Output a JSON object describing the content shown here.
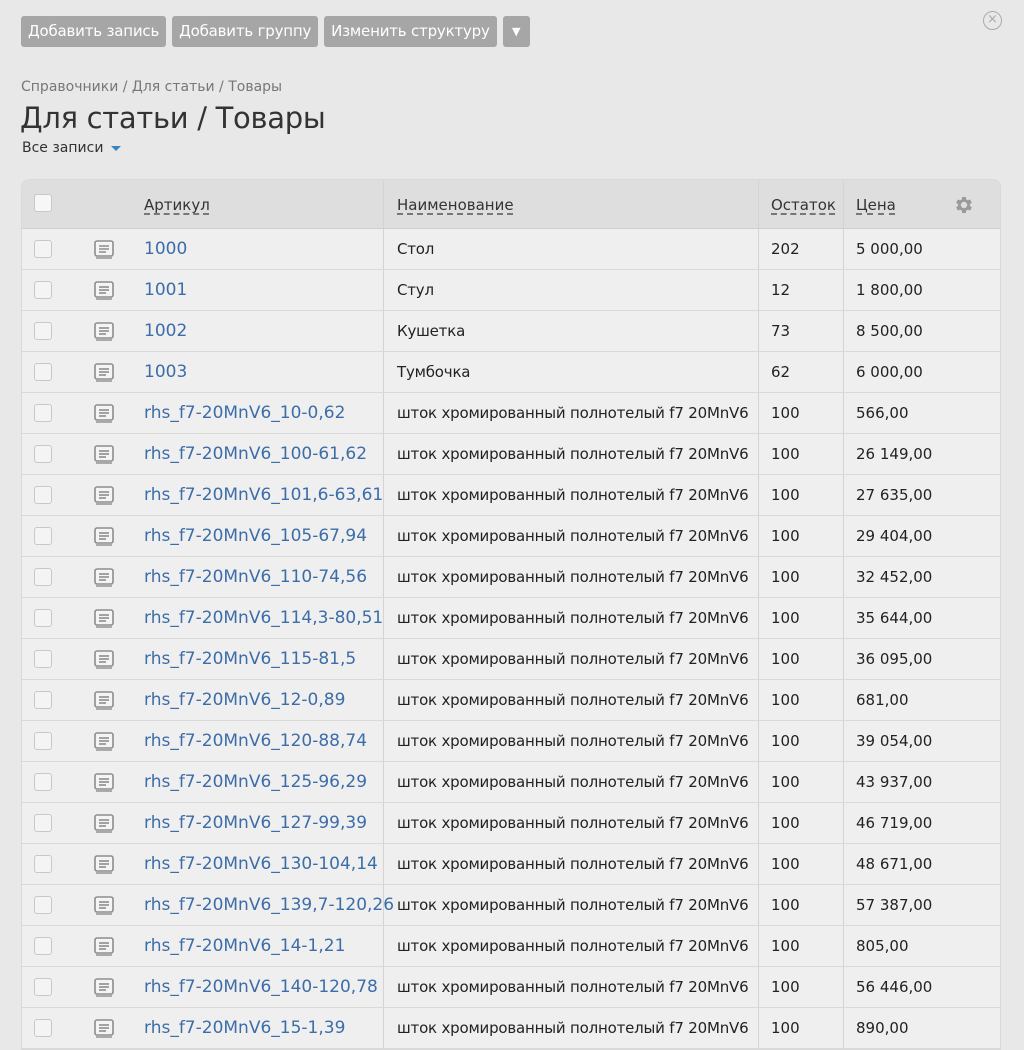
{
  "toolbar": {
    "add_record": "Добавить запись",
    "add_group": "Добавить группу",
    "change_structure": "Изменить структуру",
    "more": "▼"
  },
  "breadcrumb": "Справочники / Для статьи / Товары",
  "title": "Для статьи / Товары",
  "filter": "Все записи",
  "table": {
    "headers": {
      "article": "Артикул",
      "name": "Наименование",
      "stock": "Остаток",
      "price": "Цена"
    },
    "rows": [
      {
        "article": "1000",
        "name": "Стол",
        "stock": "202",
        "price": "5 000,00"
      },
      {
        "article": "1001",
        "name": "Стул",
        "stock": "12",
        "price": "1 800,00"
      },
      {
        "article": "1002",
        "name": "Кушетка",
        "stock": "73",
        "price": "8 500,00"
      },
      {
        "article": "1003",
        "name": "Тумбочка",
        "stock": "62",
        "price": "6 000,00"
      },
      {
        "article": "rhs_f7-20MnV6_10-0,62",
        "name": "шток хромированный полнотелый f7 20MnV6",
        "stock": "100",
        "price": "566,00"
      },
      {
        "article": "rhs_f7-20MnV6_100-61,62",
        "name": "шток хромированный полнотелый f7 20MnV6",
        "stock": "100",
        "price": "26 149,00"
      },
      {
        "article": "rhs_f7-20MnV6_101,6-63,61",
        "name": "шток хромированный полнотелый f7 20MnV6",
        "stock": "100",
        "price": "27 635,00"
      },
      {
        "article": "rhs_f7-20MnV6_105-67,94",
        "name": "шток хромированный полнотелый f7 20MnV6",
        "stock": "100",
        "price": "29 404,00"
      },
      {
        "article": "rhs_f7-20MnV6_110-74,56",
        "name": "шток хромированный полнотелый f7 20MnV6",
        "stock": "100",
        "price": "32 452,00"
      },
      {
        "article": "rhs_f7-20MnV6_114,3-80,51",
        "name": "шток хромированный полнотелый f7 20MnV6",
        "stock": "100",
        "price": "35 644,00"
      },
      {
        "article": "rhs_f7-20MnV6_115-81,5",
        "name": "шток хромированный полнотелый f7 20MnV6",
        "stock": "100",
        "price": "36 095,00"
      },
      {
        "article": "rhs_f7-20MnV6_12-0,89",
        "name": "шток хромированный полнотелый f7 20MnV6",
        "stock": "100",
        "price": "681,00"
      },
      {
        "article": "rhs_f7-20MnV6_120-88,74",
        "name": "шток хромированный полнотелый f7 20MnV6",
        "stock": "100",
        "price": "39 054,00"
      },
      {
        "article": "rhs_f7-20MnV6_125-96,29",
        "name": "шток хромированный полнотелый f7 20MnV6",
        "stock": "100",
        "price": "43 937,00"
      },
      {
        "article": "rhs_f7-20MnV6_127-99,39",
        "name": "шток хромированный полнотелый f7 20MnV6",
        "stock": "100",
        "price": "46 719,00"
      },
      {
        "article": "rhs_f7-20MnV6_130-104,14",
        "name": "шток хромированный полнотелый f7 20MnV6",
        "stock": "100",
        "price": "48 671,00"
      },
      {
        "article": "rhs_f7-20MnV6_139,7-120,26",
        "name": "шток хромированный полнотелый f7 20MnV6",
        "stock": "100",
        "price": "57 387,00"
      },
      {
        "article": "rhs_f7-20MnV6_14-1,21",
        "name": "шток хромированный полнотелый f7 20MnV6",
        "stock": "100",
        "price": "805,00"
      },
      {
        "article": "rhs_f7-20MnV6_140-120,78",
        "name": "шток хромированный полнотелый f7 20MnV6",
        "stock": "100",
        "price": "56 446,00"
      },
      {
        "article": "rhs_f7-20MnV6_15-1,39",
        "name": "шток хромированный полнотелый f7 20MnV6",
        "stock": "100",
        "price": "890,00"
      }
    ]
  }
}
